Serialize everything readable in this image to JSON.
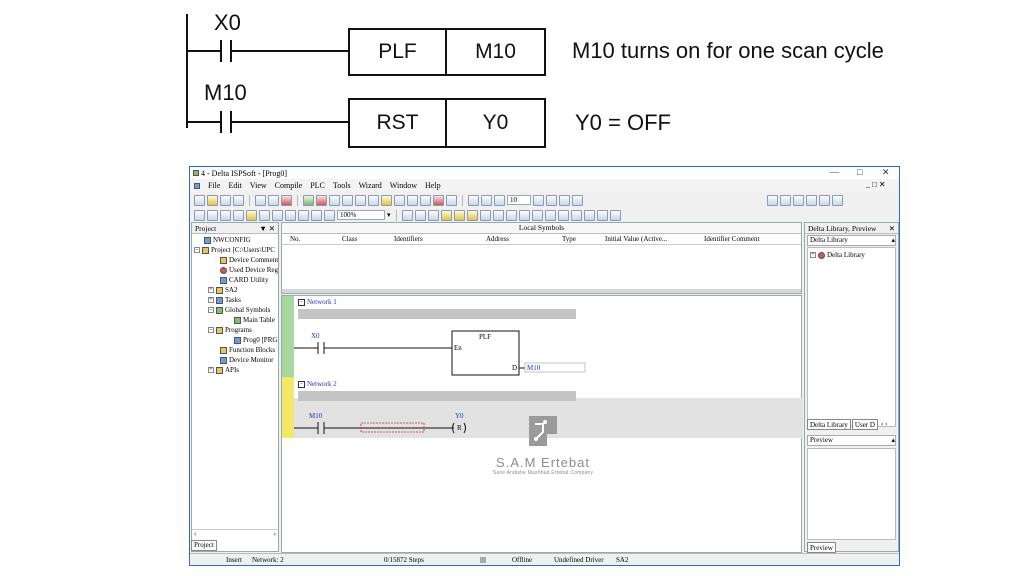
{
  "diagram": {
    "rung1_contact": "X0",
    "rung1_instruction": "PLF",
    "rung1_operand": "M10",
    "rung1_note": "M10 turns on for one scan cycle",
    "rung2_contact": "M10",
    "rung2_instruction": "RST",
    "rung2_operand": "Y0",
    "rung2_note": "Y0 = OFF"
  },
  "window": {
    "title": "4 - Delta ISPSoft - [Prog0]",
    "zoom": "100%",
    "step_input": "10"
  },
  "menu": [
    "File",
    "Edit",
    "View",
    "Compile",
    "PLC",
    "Tools",
    "Wizard",
    "Window",
    "Help"
  ],
  "project_panel": {
    "title": "Project",
    "items": [
      "NWCONFIG",
      "Project [C:\\Users\\UPC",
      "Device Comment",
      "Used Device Reg",
      "CARD Utility",
      "SA2",
      "Tasks",
      "Global Symbols",
      "Main Table",
      "Programs",
      "Prog0 [PRG",
      "Function Blocks",
      "Device Monitor",
      "APIs"
    ],
    "tab": "Project"
  },
  "local_symbols": {
    "title": "Local Symbols",
    "columns": [
      "No.",
      "Class",
      "Identifiers",
      "Address",
      "Type",
      "Initial Value (Active...",
      "Identifier Comment"
    ]
  },
  "editor": {
    "network1": "Network 1",
    "network2": "Network 2",
    "contact1": "X0",
    "fb_name": "PLF",
    "fb_input": "En",
    "fb_output": "D",
    "fb_output_var": "M10",
    "contact2": "M10",
    "coil": "Y0",
    "coil_type": "R"
  },
  "library_panel": {
    "title": "Delta Library, Preview",
    "subheader": "Delta Library",
    "item": "Delta Library",
    "tab1": "Delta Library",
    "tab2": "User D",
    "preview_title": "Preview",
    "preview_tab": "Preview"
  },
  "status_bar": {
    "mode": "Insert",
    "network": "Network: 2",
    "steps": "0/15872 Steps",
    "conn": "Offline",
    "driver": "Undefined Driver",
    "plc": "SA2"
  },
  "watermark": {
    "name": "S.A.M Ertebat",
    "sub": "Sane Andishe Mashhad Ertebat Company"
  }
}
